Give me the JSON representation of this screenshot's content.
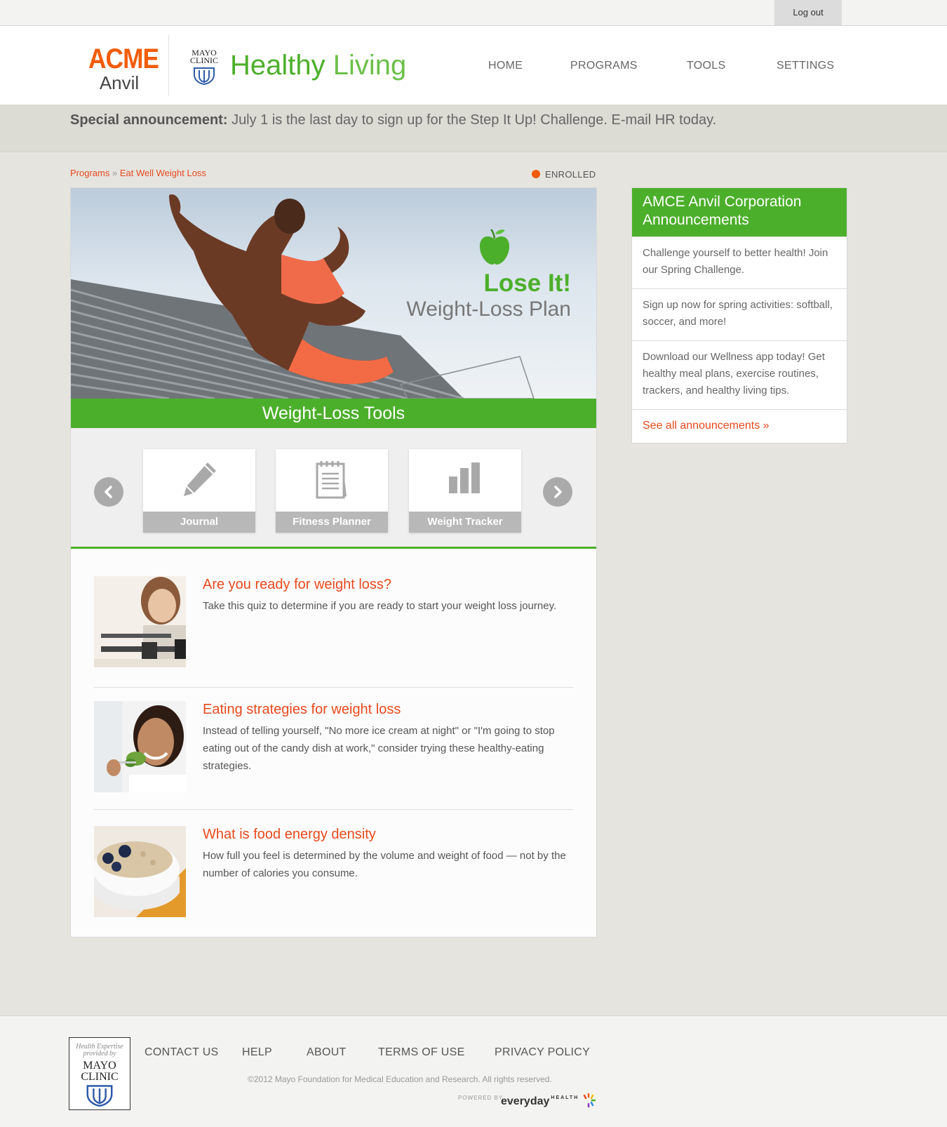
{
  "topbar": {
    "logout_label": "Log out"
  },
  "header": {
    "acme_top": "ACME",
    "acme_bottom": "Anvil",
    "mayo_line1": "MAYO",
    "mayo_line2": "CLINIC",
    "brand_word1": "Healthy",
    "brand_word2": "Living",
    "nav": [
      "HOME",
      "PROGRAMS",
      "TOOLS",
      "SETTINGS"
    ]
  },
  "announcement": {
    "label": "Special announcement:",
    "text": "July 1 is the last day to sign up for the Step It Up! Challenge. E-mail HR today."
  },
  "breadcrumb": {
    "root": "Programs",
    "separator": "»",
    "current": "Eat Well Weight Loss"
  },
  "status": {
    "label": "ENROLLED",
    "color": "#f25c05"
  },
  "hero": {
    "title": "Lose It!",
    "subtitle": "Weight-Loss Plan",
    "icon": "apple-icon"
  },
  "tools": {
    "heading": "Weight-Loss Tools",
    "items": [
      {
        "label": "Journal",
        "icon": "pencil-icon"
      },
      {
        "label": "Fitness Planner",
        "icon": "notepad-icon"
      },
      {
        "label": "Weight Tracker",
        "icon": "bar-chart-icon"
      }
    ],
    "prev_icon": "chevron-left-icon",
    "next_icon": "chevron-right-icon"
  },
  "articles": [
    {
      "title": "Are you ready for weight loss?",
      "desc": "Take this quiz to determine if you are ready to start your weight loss journey."
    },
    {
      "title": "Eating strategies for weight loss",
      "desc": "Instead of telling yourself, \"No more ice cream at night\" or \"I'm going to stop eating out of the candy dish at work,\" consider trying these healthy-eating strategies."
    },
    {
      "title": "What is food energy density",
      "desc": "How full you feel is determined by the volume and weight of food — not by the number of calories you consume."
    }
  ],
  "sidebar": {
    "heading": "AMCE Anvil Corporation Announcements",
    "items": [
      "Challenge yourself to better health! Join our Spring Challenge.",
      "Sign up now for spring activities: softball, soccer, and more!",
      "Download our Wellness app today! Get healthy meal plans, exercise routines, trackers, and healthy living tips."
    ],
    "see_all": "See all announcements »"
  },
  "footer": {
    "logo_line1": "Health Expertise",
    "logo_line2": "provided by",
    "logo_line3": "MAYO",
    "logo_line4": "CLINIC",
    "links": [
      "CONTACT US",
      "HELP",
      "ABOUT",
      "TERMS OF USE",
      "PRIVACY POLICY"
    ],
    "copyright": "©2012 Mayo Foundation for Medical Education and Research. All rights reserved.",
    "powered_by": "POWERED BY",
    "everyday": "everyday",
    "health": "HEALTH"
  },
  "colors": {
    "accent_green": "#4caf2b",
    "accent_orange": "#e8491d",
    "brand_orange": "#f25c05"
  }
}
